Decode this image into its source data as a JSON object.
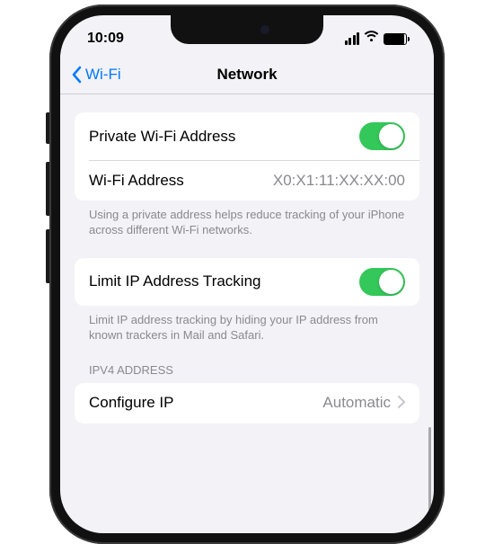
{
  "status": {
    "time": "10:09"
  },
  "nav": {
    "back_label": "Wi-Fi",
    "title": "Network"
  },
  "group1": {
    "private_wifi_label": "Private Wi-Fi Address",
    "wifi_address_label": "Wi-Fi Address",
    "wifi_address_value": "X0:X1:11:XX:XX:00",
    "footer": "Using a private address helps reduce tracking of your iPhone across different Wi-Fi networks."
  },
  "group2": {
    "limit_tracking_label": "Limit IP Address Tracking",
    "footer": "Limit IP address tracking by hiding your IP address from known trackers in Mail and Safari."
  },
  "group3": {
    "header": "IPV4 Address",
    "configure_ip_label": "Configure IP",
    "configure_ip_value": "Automatic"
  }
}
